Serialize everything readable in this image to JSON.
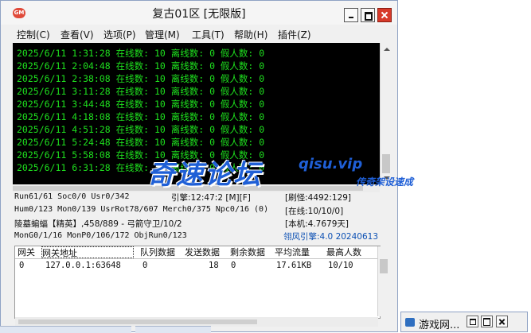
{
  "window": {
    "title": "复古01区 [无限版]",
    "icon_label": "GM"
  },
  "menu": [
    "控制(C)",
    "查看(V)",
    "选项(P)",
    "管理(M)",
    "工具(T)",
    "帮助(H)",
    "插件(Z)"
  ],
  "log_lines": [
    "2025/6/11 1:31:28 在线数: 10 离线数: 0 假人数: 0",
    "2025/6/11 2:04:48 在线数: 10 离线数: 0 假人数: 0",
    "2025/6/11 2:38:08 在线数: 10 离线数: 0 假人数: 0",
    "2025/6/11 3:11:28 在线数: 10 离线数: 0 假人数: 0",
    "2025/6/11 3:44:48 在线数: 10 离线数: 0 假人数: 0",
    "2025/6/11 4:18:08 在线数: 10 离线数: 0 假人数: 0",
    "2025/6/11 4:51:28 在线数: 10 离线数: 0 假人数: 0",
    "2025/6/11 5:24:48 在线数: 10 离线数: 0 假人数: 0",
    "2025/6/11 5:58:08 在线数: 10 离线数: 0 假人数: 0",
    "2025/6/11 6:31:28 在线数: 10 离线数: 0 假人数: 0"
  ],
  "status": {
    "run": "Run61/61 Soc0/0 Usr0/342",
    "engine": "引擎:12:47:2 [M][F]",
    "refresh": "[刷怪:4492:129]",
    "hum": "Hum0/123 Mon0/139 UsrRot78/607 Merch0/375 Npc0/16 (0)",
    "online": "[在线:10/10/0]",
    "monster": "陵墓蝙蝠【精英】,458/889 - 弓箭守卫/10/2",
    "local": "[本机:4.7679天]",
    "mongo": "MonG0/1/16 MonP0/106/172 ObjRun0/123",
    "version": "翎风引擎:4.0 20240613"
  },
  "table": {
    "headers": [
      "网关",
      "网关地址",
      "队列数据",
      "发送数据",
      "剩余数据",
      "平均流量",
      "最高人数"
    ],
    "rows": [
      [
        "0",
        "127.0.0.1:63648",
        "0",
        "18",
        "0",
        "17.61KB",
        "10/10"
      ]
    ]
  },
  "minimized": {
    "title": "游戏网..."
  },
  "watermark": {
    "main": "奇速论坛",
    "site": "qisu.vip",
    "sub": "传奇架设速成"
  },
  "colors": {
    "console_bg": "#000000",
    "console_text": "#1ee01e",
    "close_red": "#d73a2a",
    "watermark_blue": "#1f5fd6"
  }
}
